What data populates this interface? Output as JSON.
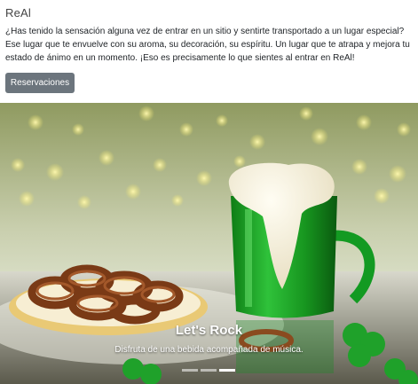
{
  "brand": "ReAl",
  "intro_text": "¿Has tenido la sensación alguna vez de entrar en un sitio y sentirte transportado a un lugar especial? Ese lugar que te envuelve con su aroma, su decoración, su espíritu. Un lugar que te atrapa y mejora tu estado de ánimo en un momento. ¡Eso es precisamente lo que sientes al entrar en ReAl!",
  "reservations_button": "Reservaciones",
  "carousel": {
    "slide_title": "Let's Rock",
    "slide_text": "Disfruta de una bebida acompañada de música.",
    "indicators": [
      {
        "active": false
      },
      {
        "active": false
      },
      {
        "active": true
      }
    ]
  }
}
